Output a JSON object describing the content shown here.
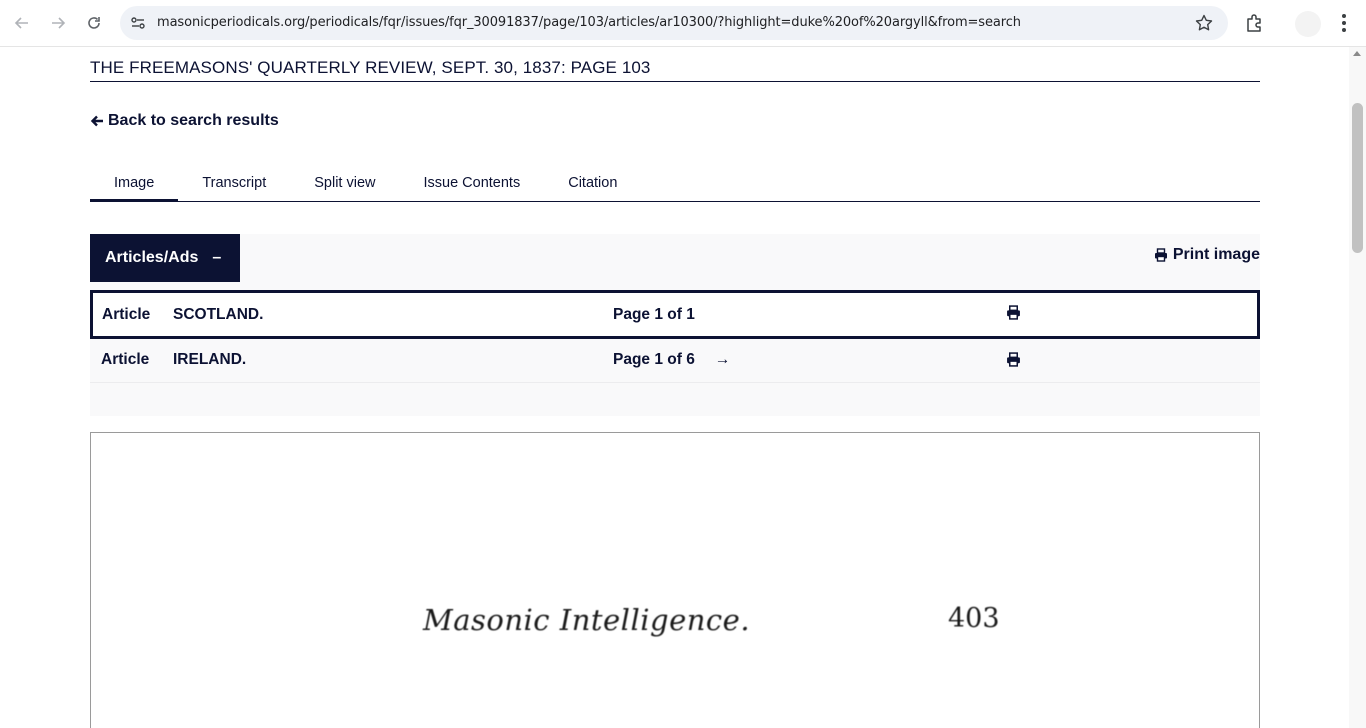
{
  "browser": {
    "url": "masonicperiodicals.org/periodicals/fqr/issues/fqr_30091837/page/103/articles/ar10300/?highlight=duke%20of%20argyll&from=search"
  },
  "page": {
    "title": "THE FREEMASONS' QUARTERLY REVIEW, SEPT. 30, 1837: PAGE 103",
    "back_link": "Back to search results",
    "tabs": [
      {
        "label": "Image",
        "active": true
      },
      {
        "label": "Transcript",
        "active": false
      },
      {
        "label": "Split view",
        "active": false
      },
      {
        "label": "Issue Contents",
        "active": false
      },
      {
        "label": "Citation",
        "active": false
      }
    ],
    "panel": {
      "articles_button": "Articles/Ads",
      "articles_toggle": "–",
      "print_image": "Print image",
      "rows": [
        {
          "kind": "Article",
          "name": "SCOTLAND.",
          "page_info": "Page 1 of 1",
          "next": ""
        },
        {
          "kind": "Article",
          "name": "IRELAND.",
          "page_info": "Page 1 of 6",
          "next": "→"
        }
      ]
    },
    "scan": {
      "heading": "Masonic Intelligence.",
      "page_number": "403"
    }
  }
}
